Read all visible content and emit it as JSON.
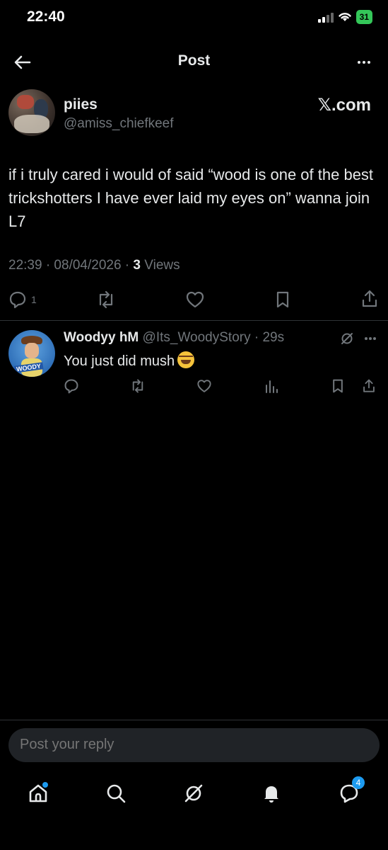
{
  "status_bar": {
    "time": "22:40",
    "battery": "31"
  },
  "header": {
    "title": "Post"
  },
  "post": {
    "author_name": "piies",
    "author_handle": "@amiss_chiefkeef",
    "brand": "𝕏.com",
    "text": "if i truly cared i would of said “wood is one of the best trickshotters I have ever laid my eyes on” wanna join L7",
    "time": "22:39 · 08/04/2026 · ",
    "views_count": "3",
    "views_label": " Views",
    "reply_count": "1"
  },
  "reply": {
    "author_name": "Woodyy hM",
    "author_handle": "@Its_WoodyStory · 29s",
    "text": "You just did mush",
    "avatar_tag": "WOODY"
  },
  "composer": {
    "placeholder": "Post your reply"
  },
  "tabbar": {
    "messages_badge": "4"
  },
  "colors": {
    "background": "#000000",
    "text": "#e7e9ea",
    "muted": "#71767b",
    "accent": "#1d9bf0",
    "divider": "#2f3336"
  }
}
